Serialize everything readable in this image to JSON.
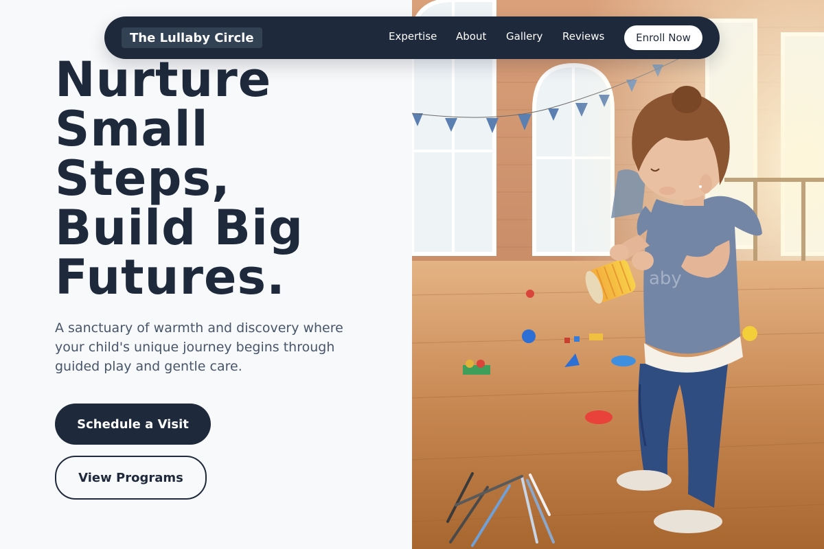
{
  "nav": {
    "brand": "The Lullaby Circle",
    "links": [
      "Expertise",
      "About",
      "Gallery",
      "Reviews"
    ],
    "cta": "Enroll Now"
  },
  "hero": {
    "headline_lines": [
      "Nurture",
      "Small",
      "Steps,",
      "Build Big",
      "Futures."
    ],
    "subtext": "A sanctuary of warmth and discovery where your child's unique journey begins through guided play and gentle care.",
    "primary_button": "Schedule a Visit",
    "secondary_button": "View Programs",
    "photo_watermark": "aby"
  },
  "colors": {
    "navy": "#1e293b",
    "page_background": "#f8f9fa",
    "body_text": "#475569"
  }
}
